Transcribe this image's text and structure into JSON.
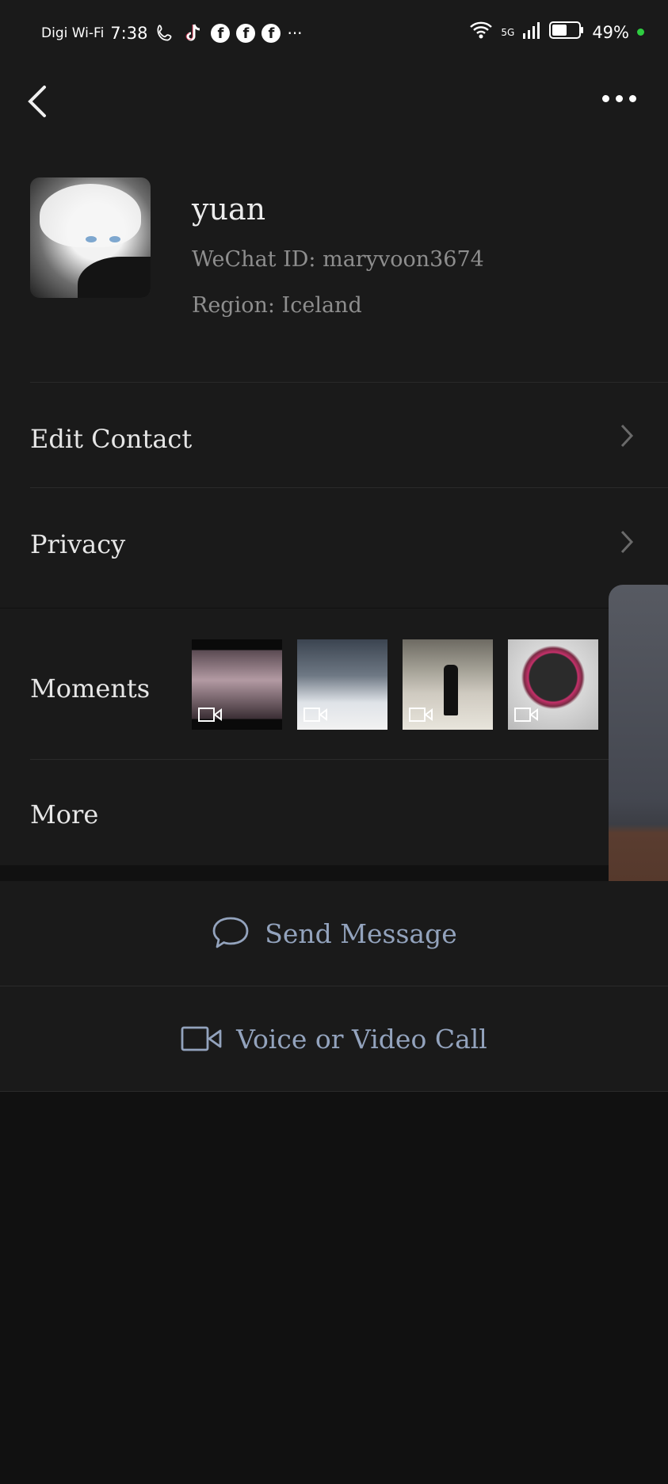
{
  "status_bar": {
    "carrier": "Digi Wi-Fi",
    "time": "7:38",
    "network": "5G",
    "battery": "49%"
  },
  "profile": {
    "name": "yuan",
    "wechat_id": "WeChat ID: maryvoon3674",
    "region": "Region: Iceland"
  },
  "menu": {
    "edit_contact": "Edit Contact",
    "privacy": "Privacy",
    "moments": "Moments",
    "more": "More"
  },
  "actions": {
    "send_message": "Send Message",
    "call": "Voice or Video Call"
  },
  "icons": [
    "back-arrow-icon",
    "more-dots-icon",
    "chevron-right-icon",
    "video-icon",
    "chat-bubble-icon",
    "video-camera-icon"
  ]
}
